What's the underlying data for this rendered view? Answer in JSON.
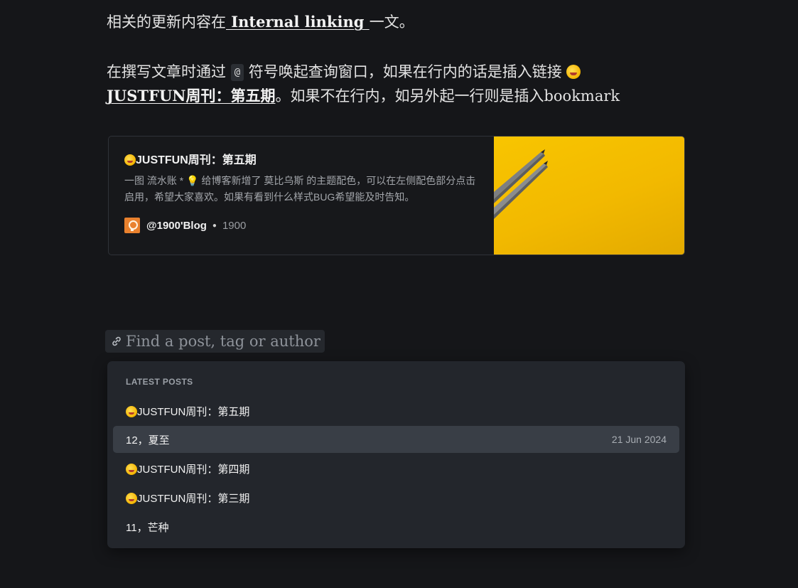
{
  "article": {
    "line1_prefix": "相关的更新内容在",
    "line1_link": " Internal linking ",
    "line1_suffix": "一文。",
    "line2_prefix": "在撰写文章时通过 ",
    "line2_code": "@",
    "line2_middle": " 符号唤起查询窗口，如果在行内的话是插入链接 ",
    "line3_link": "JUSTFUN周刊：第五期",
    "line3_suffix": "。如果不在行内，如另外起一行则是插入bookmark"
  },
  "bookmark": {
    "title": "JUSTFUN周刊：第五期",
    "description": "一图 流水账 * 💡 给博客新增了 莫比乌斯 的主题配色，可以在左侧配色部分点击启用，希望大家喜欢。如果有看到什么样式BUG希望能及时告知。",
    "author": "@1900'Blog",
    "publisher": "1900",
    "icon": "lightbulb-icon"
  },
  "search": {
    "placeholder": "Find a post, tag or author",
    "icon": "link-icon"
  },
  "dropdown": {
    "heading": "LATEST POSTS",
    "posts": [
      {
        "title": "JUSTFUN周刊：第五期",
        "emoji": true,
        "date": ""
      },
      {
        "title": "12，夏至",
        "emoji": false,
        "date": "21 Jun 2024"
      },
      {
        "title": "JUSTFUN周刊：第四期",
        "emoji": true,
        "date": ""
      },
      {
        "title": "JUSTFUN周刊：第三期",
        "emoji": true,
        "date": ""
      },
      {
        "title": "11，芒种",
        "emoji": false,
        "date": ""
      }
    ],
    "active_index": 1
  },
  "colors": {
    "background": "#151619",
    "panel": "#23262c",
    "active_row": "#393e46",
    "thumbnail": "#f2b900"
  }
}
